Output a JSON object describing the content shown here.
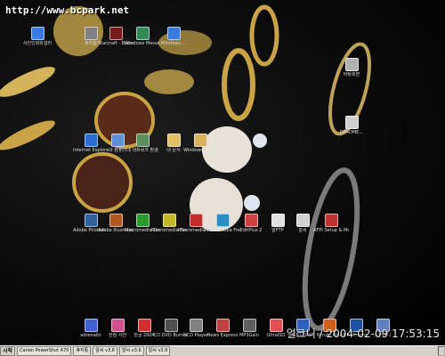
{
  "watermark": "http://www.bcpark.net",
  "timestamp": "얼크니 / 2004-02-09 17:53:15",
  "desktop_icons": [
    {
      "label": "사진인화와컬러",
      "color": "#3b7be0"
    },
    {
      "label": "휴지통",
      "color": "#808080"
    },
    {
      "label": "Starcraft - Brood War",
      "color": "#7a1b1b"
    },
    {
      "label": "Windows Messenger",
      "color": "#2e8b57"
    },
    {
      "label": "Windows ...",
      "color": "#3b7be0"
    },
    {
      "label": "바탕화면",
      "color": "#b0b0b0"
    },
    {
      "label": "Internet Explorer",
      "color": "#2a6cd1"
    },
    {
      "label": "내 컴퓨터",
      "color": "#5f8fd6"
    },
    {
      "label": "내 네트워크 환경",
      "color": "#5b8f5b"
    },
    {
      "label": "내 문서",
      "color": "#e0c060"
    },
    {
      "label": "Windows 탐색기",
      "color": "#d6b25b"
    },
    {
      "label": "README...",
      "color": "#cfcfcf"
    },
    {
      "label": "Adobe Photosh...",
      "color": "#315f9a"
    },
    {
      "label": "Adobe Illustrator 10",
      "color": "#b05a20"
    },
    {
      "label": "Macromedia Dreamwe...",
      "color": "#2c9a2c"
    },
    {
      "label": "Macromedia Firework...",
      "color": "#c5b62a"
    },
    {
      "label": "Macromedia Flash MX",
      "color": "#c42b2b"
    },
    {
      "label": "Macromedia FreeHand",
      "color": "#2b8fc4"
    },
    {
      "label": "EditPlus 2",
      "color": "#d04040"
    },
    {
      "label": "알FTP",
      "color": "#e0e0e0"
    },
    {
      "label": "알씨",
      "color": "#d0d0d0"
    },
    {
      "label": "AFPI Setup & Monitor",
      "color": "#c03030"
    },
    {
      "label": "adrenalin",
      "color": "#4060d0"
    },
    {
      "label": "한컴 사전",
      "color": "#d05090"
    },
    {
      "label": "한글 2004",
      "color": "#d03030"
    },
    {
      "label": "CD DVD Burner",
      "color": "#505050"
    },
    {
      "label": "GCD Player",
      "color": "#808080"
    },
    {
      "label": "News Express",
      "color": "#c04040"
    },
    {
      "label": "MP3Gain",
      "color": "#606060"
    },
    {
      "label": "UltraISO",
      "color": "#e05050"
    },
    {
      "label": "포토나 PXP",
      "color": "#3060c0"
    },
    {
      "label": "Winzip Plus",
      "color": "#d06020"
    },
    {
      "label": "HP Director",
      "color": "#2050a0"
    },
    {
      "label": "쇼텐바디",
      "color": "#6080c0"
    }
  ],
  "taskbar": {
    "start_label": "시작",
    "tasks": [
      "Canon PowerShot A70",
      "휴지통",
      "알씨 v3.6",
      "알씨 v3.6",
      "알씨 v3.6"
    ],
    "tray_text": ""
  }
}
